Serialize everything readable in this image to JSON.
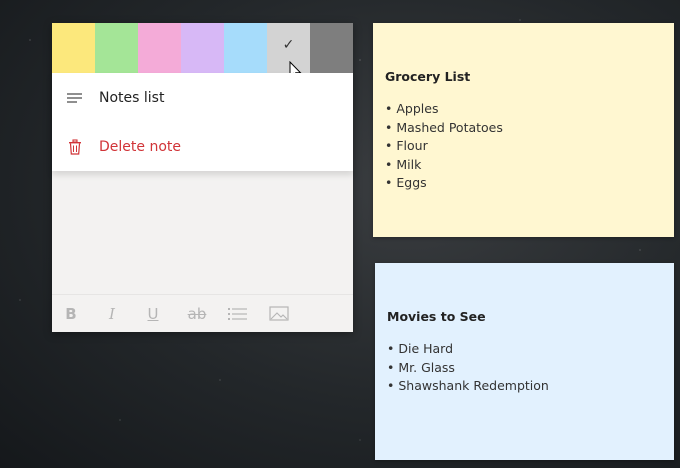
{
  "menu_note": {
    "swatches": [
      {
        "name": "yellow",
        "color": "#fce87c",
        "selected": false
      },
      {
        "name": "green",
        "color": "#a4e597",
        "selected": false
      },
      {
        "name": "pink",
        "color": "#f4abd8",
        "selected": false
      },
      {
        "name": "purple",
        "color": "#d7b8f6",
        "selected": false
      },
      {
        "name": "blue",
        "color": "#a6dcfb",
        "selected": false
      },
      {
        "name": "gray",
        "color": "#d3d3d3",
        "selected": true
      },
      {
        "name": "charcoal",
        "color": "#7e7e7e",
        "selected": false
      }
    ],
    "check_glyph": "✓",
    "menu": {
      "notes_list_label": "Notes list",
      "delete_note_label": "Delete note"
    },
    "toolbar": {
      "bold": "B",
      "italic": "I",
      "underline": "U",
      "strikethrough": "ab"
    },
    "icons": {
      "notes_list": "hamburger-icon",
      "delete": "trash-icon",
      "bullets": "bullet-list-icon",
      "image": "image-icon"
    }
  },
  "notes": [
    {
      "title": "Grocery List",
      "items": [
        "Apples",
        "Mashed Potatoes",
        "Flour",
        "Milk",
        "Eggs"
      ],
      "color": "#fff7d1"
    },
    {
      "title": "Movies to See",
      "items": [
        "Die Hard",
        "Mr. Glass",
        "Shawshank Redemption"
      ],
      "color": "#e2f1fe"
    }
  ]
}
